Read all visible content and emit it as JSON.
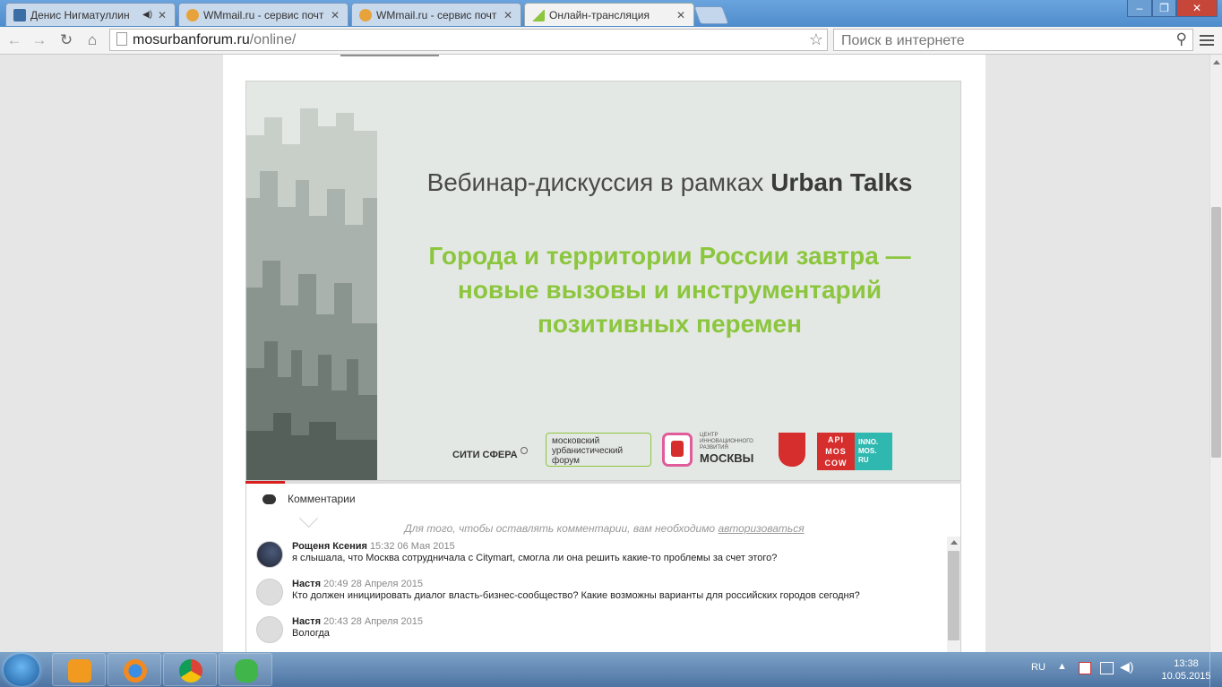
{
  "browser": {
    "tabs": [
      {
        "label": "Денис Нигматуллин",
        "audio": true,
        "active": false
      },
      {
        "label": "WMmail.ru - сервис почт",
        "audio": false,
        "active": false
      },
      {
        "label": "WMmail.ru - сервис почт",
        "audio": false,
        "active": false
      },
      {
        "label": "Онлайн-трансляция",
        "audio": false,
        "active": true
      }
    ],
    "url_host": "mosurbanforum.ru",
    "url_path": "/online/",
    "search_placeholder": "Поиск в интернете",
    "window_buttons": [
      "–",
      "❐",
      "✕"
    ]
  },
  "banner": {
    "top_line_prefix": "Вебинар-дискуссия в рамках",
    "top_line_brand": "Urban Talks",
    "main_line_1": "Города и территории России завтра —",
    "main_line_2": "новые вызовы и инструментарий",
    "main_line_3": "позитивных перемен",
    "logos": {
      "siti": "СИТИ СФЕРА",
      "muf_1": "московский",
      "muf_2": "урбанистический",
      "muf_3": "форум",
      "cir_1": "ЦЕНТР",
      "cir_2": "ИННОВАЦИОННОГО",
      "cir_3": "РАЗВИТИЯ",
      "cir_4": "МОСКВЫ",
      "api": "API MOS COW",
      "inno_1": "INNO.",
      "inno_2": "MOS.",
      "inno_3": "RU"
    }
  },
  "comments": {
    "tab_label": "Комментарии",
    "auth_text": "Для того, чтобы оставлять комментарии, вам необходимо",
    "auth_link": "авторизоваться",
    "items": [
      {
        "name": "Рощеня Ксения",
        "date": "15:32 06 Мая 2015",
        "text": "я слышала, что Москва сотрудничала с Citymart, смогла ли она решить какие-то проблемы за счет этого?"
      },
      {
        "name": "Настя",
        "date": "20:49 28 Апреля 2015",
        "text": "Кто должен инициировать диалог власть-бизнес-сообщество? Какие возможны варианты для российских городов сегодня?"
      },
      {
        "name": "Настя",
        "date": "20:43 28 Апреля 2015",
        "text": "Вологда"
      }
    ]
  },
  "taskbar": {
    "lang": "RU",
    "time": "13:38",
    "date": "10.05.2015"
  },
  "colors": {
    "accent_green": "#8cc63f",
    "progress_red": "#d81e1e"
  }
}
